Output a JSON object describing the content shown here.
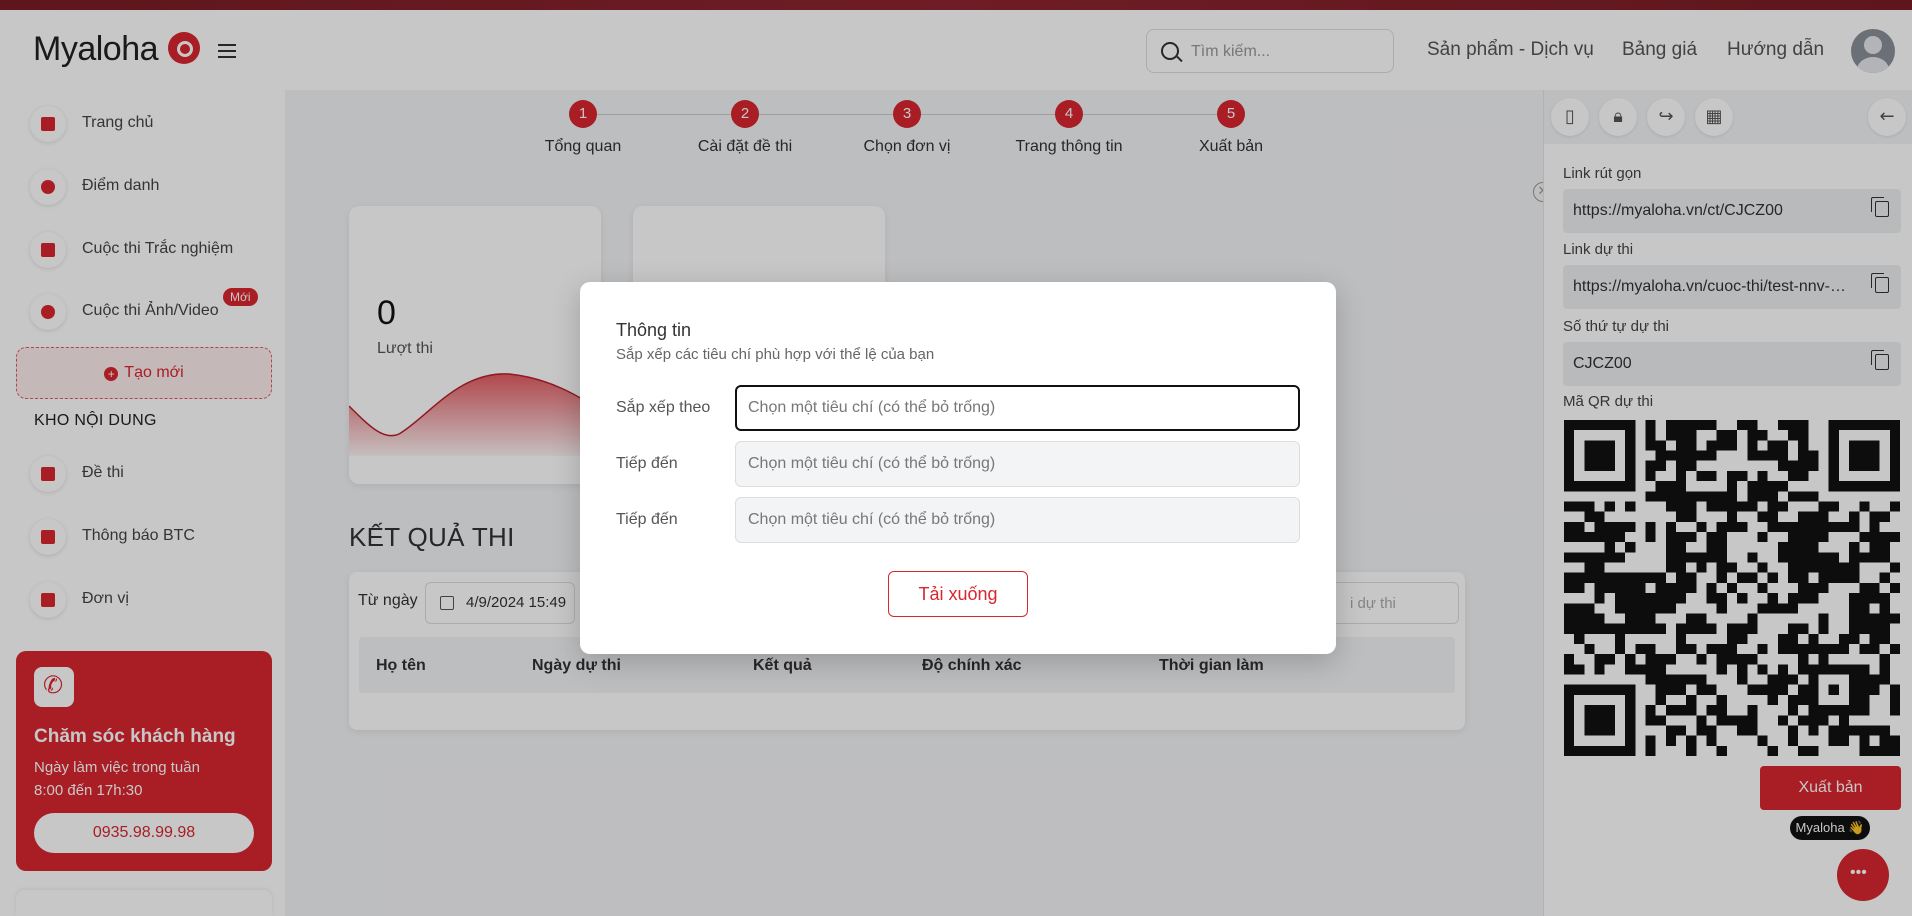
{
  "header": {
    "logo": "Myaloha",
    "search_placeholder": "Tìm kiếm...",
    "nav": [
      "Sản phẩm - Dịch vụ",
      "Bảng giá",
      "Hướng dẫn"
    ]
  },
  "sidebar": {
    "items": [
      {
        "label": "Trang chủ",
        "icon": "home-icon"
      },
      {
        "label": "Điểm danh",
        "icon": "user-icon"
      },
      {
        "label": "Cuộc thi Trắc nghiệm",
        "icon": "bar-chart-icon"
      },
      {
        "label": "Cuộc thi Ảnh/Video",
        "icon": "send-icon",
        "badge": "Mới"
      }
    ],
    "create_label": "Tạo mới",
    "section_title": "KHO NỘI DUNG",
    "content_items": [
      {
        "label": "Đề thi",
        "icon": "file-icon"
      },
      {
        "label": "Thông báo BTC",
        "icon": "book-icon"
      },
      {
        "label": "Đơn vị",
        "icon": "shopping-bag-icon"
      }
    ],
    "care": {
      "title": "Chăm sóc khách hàng",
      "line1": "Ngày làm việc trong tuần",
      "line2": "8:00 đến 17h:30",
      "phone": "0935.98.99.98"
    }
  },
  "stepper": [
    {
      "num": "1",
      "label": "Tổng quan"
    },
    {
      "num": "2",
      "label": "Cài đặt đề thi"
    },
    {
      "num": "3",
      "label": "Chọn đơn vị"
    },
    {
      "num": "4",
      "label": "Trang thông tin"
    },
    {
      "num": "5",
      "label": "Xuất bản"
    }
  ],
  "stats": {
    "value": "0",
    "label": "Lượt thi"
  },
  "results": {
    "title": "KẾT QUẢ THI",
    "from_label": "Từ ngày",
    "from_date": "4/9/2024 15:49",
    "filter_placeholder": "i dự thi",
    "columns": [
      "Họ tên",
      "Ngày dự thi",
      "Kết quả",
      "Độ chính xác",
      "Thời gian làm"
    ]
  },
  "right_panel": {
    "short_link_label": "Link rút gọn",
    "short_link": "https://myaloha.vn/ct/CJCZ00",
    "contest_link_label": "Link dự thi",
    "contest_link": "https://myaloha.vn/cuoc-thi/test-nnv-d-...",
    "order_label": "Số thứ tự dự thi",
    "order_value": "CJCZ00",
    "qr_label": "Mã QR dự thi",
    "publish_label": "Xuất bản",
    "brand_chip": "Myaloha 👋"
  },
  "modal": {
    "title": "Thông tin",
    "subtitle": "Sắp xếp các tiêu chí phù hợp với thể lệ của bạn",
    "rows": [
      {
        "label": "Sắp xếp theo",
        "placeholder": "Chọn một tiêu chí (có thể bỏ trống)"
      },
      {
        "label": "Tiếp đến",
        "placeholder": "Chọn một tiêu chí (có thể bỏ trống)"
      },
      {
        "label": "Tiếp đến",
        "placeholder": "Chọn một tiêu chí (có thể bỏ trống)"
      }
    ],
    "download_label": "Tải xuống"
  },
  "colors": {
    "accent": "#d9262f"
  }
}
